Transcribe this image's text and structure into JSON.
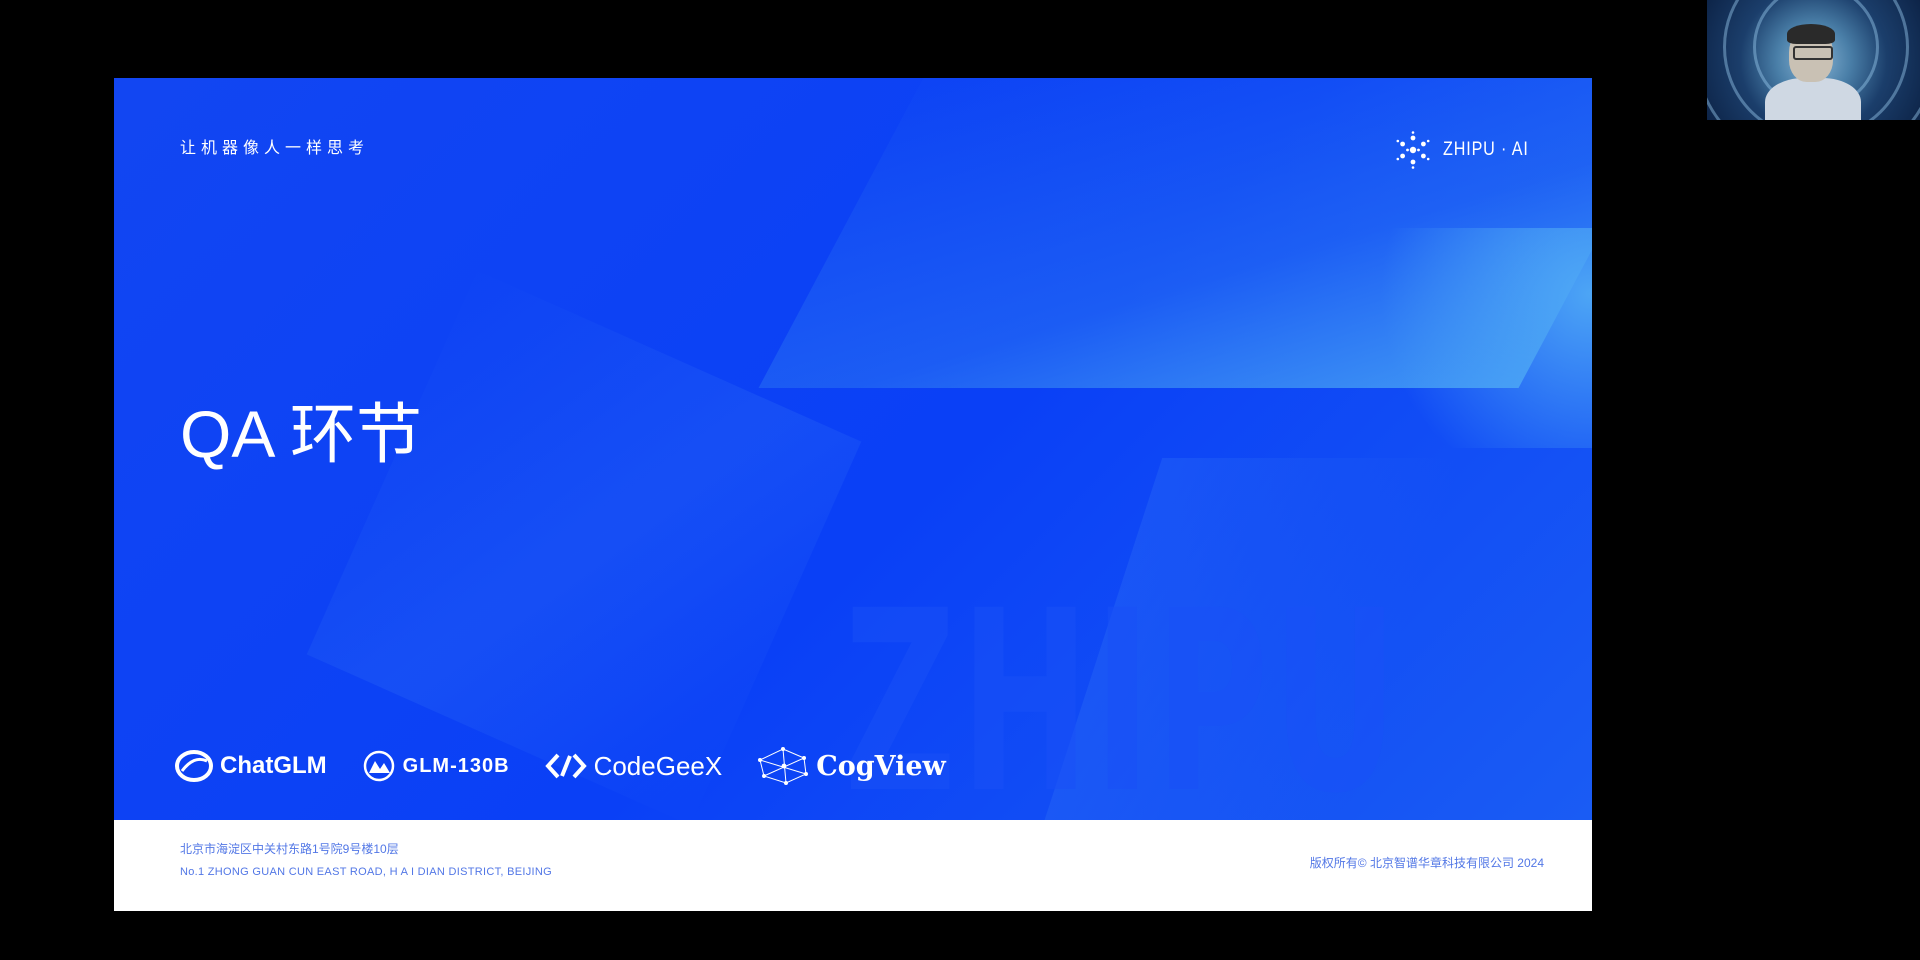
{
  "slide": {
    "tagline": "让机器像人一样思考",
    "brand": {
      "name": "ZHIPU · AI",
      "icon": "zhipu-logo-icon"
    },
    "title": "QA 环节",
    "watermark": "ZHIPU",
    "products": [
      {
        "name": "ChatGLM",
        "icon": "chatglm-logo-icon"
      },
      {
        "name": "GLM-130B",
        "icon": "glm-130b-logo-icon"
      },
      {
        "name": "CodeGeeX",
        "icon": "codegeex-logo-icon"
      },
      {
        "name": "CogView",
        "icon": "cogview-logo-icon"
      }
    ],
    "footer": {
      "address_cn": "北京市海淀区中关村东路1号院9号楼10层",
      "address_en": "No.1 ZHONG GUAN CUN EAST ROAD, H A I DIAN DISTRICT, BEIJING",
      "copyright": "版权所有© 北京智谱华章科技有限公司 2024"
    }
  },
  "webcam": {
    "label": "presenter-video"
  },
  "colors": {
    "background": "#000000",
    "slide_blue": "#0a3df0",
    "accent_light_blue": "#3a8cf0",
    "footer_bg": "#ffffff",
    "footer_text": "#5277e6"
  }
}
